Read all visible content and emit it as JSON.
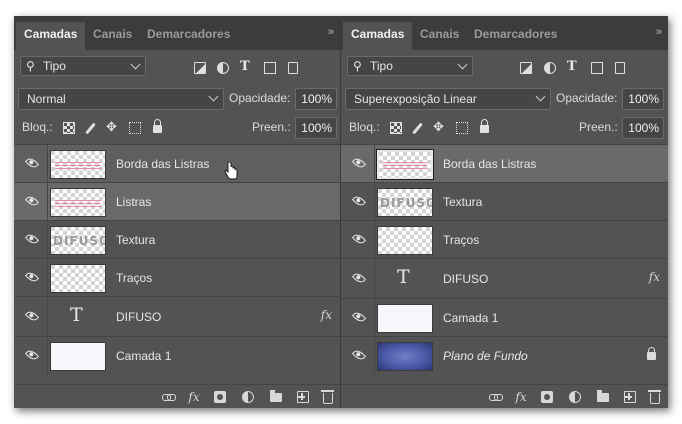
{
  "tabs": [
    "Camadas",
    "Canais",
    "Demarcadores"
  ],
  "tab_menu_glyph": "»",
  "filter": {
    "label": "Tipo"
  },
  "labels": {
    "opacity": "Opacidade:",
    "lock": "Bloq.:",
    "fill": "Preen.:"
  },
  "left": {
    "blend_mode": "Normal",
    "opacity": "100%",
    "fill": "100%",
    "layers": [
      {
        "name": "Borda das Listras",
        "thumb": "stripes",
        "state": "hovered"
      },
      {
        "name": "Listras",
        "thumb": "stripes",
        "state": "selected"
      },
      {
        "name": "Textura",
        "thumb": "difuso",
        "state": "normal"
      },
      {
        "name": "Traços",
        "thumb": "transparent",
        "state": "normal"
      },
      {
        "name": "DIFUSO",
        "thumb": "text",
        "state": "normal",
        "fx": "fx"
      },
      {
        "name": "Camada 1",
        "thumb": "white",
        "state": "normal"
      }
    ]
  },
  "right": {
    "blend_mode": "Superexposição Linear",
    "opacity": "100%",
    "fill": "100%",
    "layers": [
      {
        "name": "Borda das Listras",
        "thumb": "stripes",
        "state": "selected"
      },
      {
        "name": "Textura",
        "thumb": "difuso",
        "state": "normal"
      },
      {
        "name": "Traços",
        "thumb": "transparent",
        "state": "normal"
      },
      {
        "name": "DIFUSO",
        "thumb": "text",
        "state": "normal",
        "fx": "fx"
      },
      {
        "name": "Camada 1",
        "thumb": "white",
        "state": "normal"
      },
      {
        "name": "Plano de Fundo",
        "thumb": "blue",
        "state": "normal",
        "locked": true
      }
    ]
  },
  "thumb_text": "DIFUSO",
  "text_layer_glyph": "T",
  "fx_glyph": "fx",
  "colors": {
    "panel_bg": "#535353",
    "tabbar_bg": "#3c3c3c",
    "selected_row": "#6a6a6a",
    "background_layer": "#4a5aa8"
  }
}
